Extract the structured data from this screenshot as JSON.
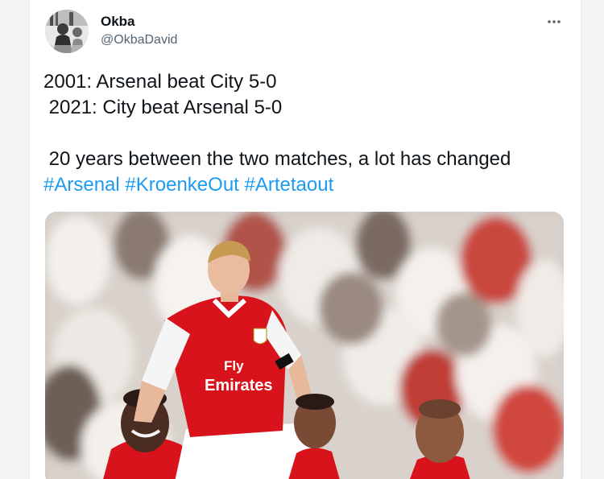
{
  "tweet": {
    "author": {
      "display_name": "Okba",
      "handle": "@OkbaDavid",
      "avatar": "avatar-photo"
    },
    "more_icon": "more-horizontal-icon",
    "lines": [
      "2001: Arsenal beat City 5-0",
      " 2021: City beat Arsenal 5-0",
      "",
      " 20 years between the two matches, a lot has changed"
    ],
    "hashtags": [
      "#Arsenal",
      "#KroenkeOut",
      "#Artetaout"
    ],
    "media": {
      "kind": "photo",
      "shirt_text_1": "Fly",
      "shirt_text_2": "Emirates"
    }
  },
  "colors": {
    "hashtag": "#1d9bf0",
    "text": "#0f1419",
    "secondary_text": "#536471",
    "arsenal_red": "#d8131b"
  }
}
